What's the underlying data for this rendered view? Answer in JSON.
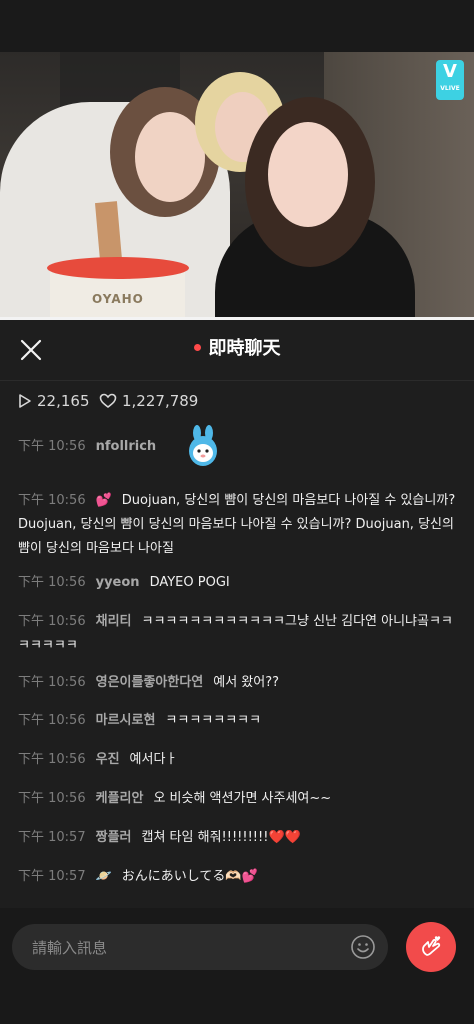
{
  "video": {
    "badge_label": "VLIVE",
    "cup_text": "OYAHO"
  },
  "header": {
    "title": "即時聊天",
    "live_dot_color": "#ff4a4a",
    "close_icon": "close-icon"
  },
  "stats": {
    "plays": "22,165",
    "likes": "1,227,789"
  },
  "messages": [
    {
      "time": "下午 10:56",
      "user": "nfollrich",
      "text": "",
      "sticker": "blue-mascot-sticker"
    },
    {
      "time": "下午 10:56",
      "user": "💕",
      "text": "Duojuan, 당신의 뺨이 당신의 마음보다 나아질 수 있습니까?Duojuan, 당신의 뺨이 당신의 마음보다 나아질 수 있습니까? Duojuan, 당신의 뺨이 당신의 마음보다 나아질"
    },
    {
      "time": "下午 10:56",
      "user": "yyeon",
      "text": "DAYEO POGI"
    },
    {
      "time": "下午 10:56",
      "user": "채리티",
      "text": "ㅋㅋㅋㅋㅋㅋㅋㅋㅋㅋㅋㅋ그냥 신난 김다연 아니냐곸ㅋㅋㅋㅋㅋㅋㅋ"
    },
    {
      "time": "下午 10:56",
      "user": "영은이를좋아한다연",
      "text": "예서 왔어??"
    },
    {
      "time": "下午 10:56",
      "user": "마르시로현",
      "text": "ㅋㅋㅋㅋㅋㅋㅋㅋ"
    },
    {
      "time": "下午 10:56",
      "user": "우진",
      "text": "예서다ㅏ"
    },
    {
      "time": "下午 10:56",
      "user": "케플리안",
      "text": "오 비슷해 액션가면 사주세여~~"
    },
    {
      "time": "下午 10:57",
      "user": "짱플러",
      "text": "캡쳐 타임 해줘!!!!!!!!!",
      "hearts": "❤️❤️"
    },
    {
      "time": "下午 10:57",
      "user": "🪐",
      "text": "おんにあいしてる🫶🏻💕"
    }
  ],
  "composer": {
    "placeholder": "請輸入訊息",
    "emoji_icon": "smiley-icon",
    "send_heart_icon": "finger-heart-icon",
    "accent_color": "#f24b4b"
  }
}
